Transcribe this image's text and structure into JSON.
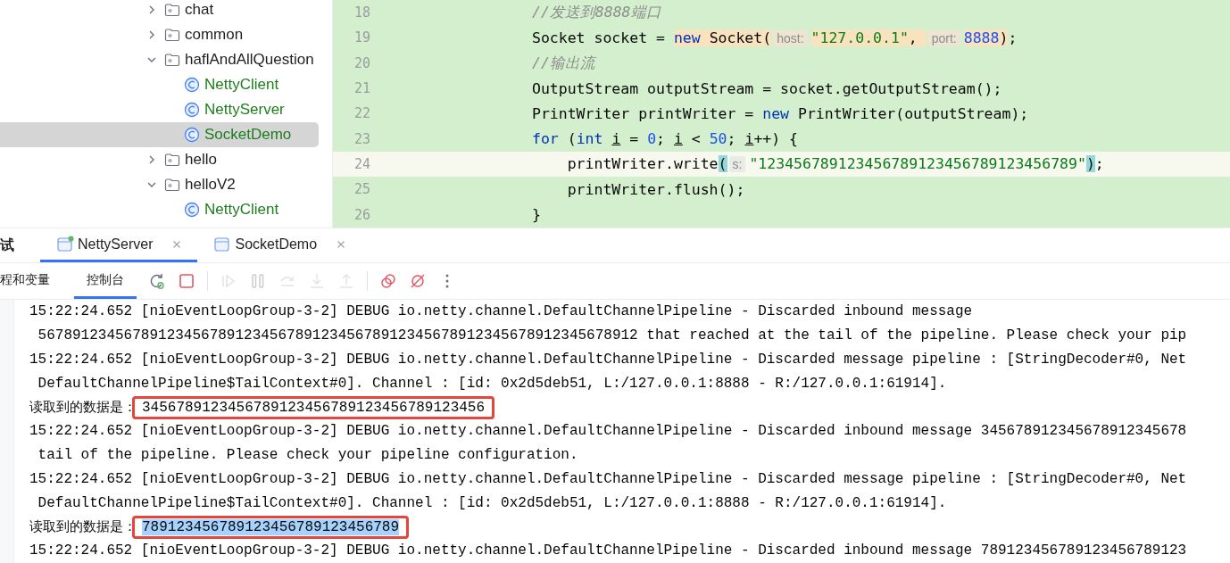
{
  "project_tree": {
    "items": [
      {
        "kind": "folder",
        "label": "chat",
        "expanded": false,
        "selected": false
      },
      {
        "kind": "folder",
        "label": "common",
        "expanded": false,
        "selected": false
      },
      {
        "kind": "folder",
        "label": "haflAndAllQuestion",
        "expanded": true,
        "selected": false,
        "children": [
          {
            "kind": "class",
            "label": "NettyClient",
            "selected": false
          },
          {
            "kind": "class",
            "label": "NettyServer",
            "selected": false
          },
          {
            "kind": "class",
            "label": "SocketDemo",
            "selected": true
          }
        ]
      },
      {
        "kind": "folder",
        "label": "hello",
        "expanded": false,
        "selected": false
      },
      {
        "kind": "folder",
        "label": "helloV2",
        "expanded": true,
        "selected": false,
        "children": [
          {
            "kind": "class",
            "label": "NettyClient",
            "selected": false
          }
        ]
      }
    ]
  },
  "editor": {
    "lines": [
      {
        "number": "18",
        "current": false,
        "tokens": [
          {
            "kind": "comment",
            "text": "                //发送到8888端口",
            "highlighted": false
          }
        ]
      },
      {
        "number": "19",
        "current": false,
        "tokens": [
          {
            "kind": "plain",
            "text": "                Socket socket = ",
            "highlighted": false
          },
          {
            "kind": "keyword",
            "text": "new",
            "highlighted": true
          },
          {
            "kind": "plain",
            "text": " Socket(",
            "highlighted": true
          },
          {
            "kind": "hint",
            "text": "host:",
            "highlighted": true
          },
          {
            "kind": "string",
            "text": "\"127.0.0.1\"",
            "highlighted": true
          },
          {
            "kind": "plain",
            "text": ", ",
            "highlighted": true
          },
          {
            "kind": "hint",
            "text": "port:",
            "highlighted": true
          },
          {
            "kind": "number",
            "text": "8888",
            "highlighted": true
          },
          {
            "kind": "plain",
            "text": ")",
            "highlighted": true
          },
          {
            "kind": "plain",
            "text": ";",
            "highlighted": false
          }
        ]
      },
      {
        "number": "20",
        "current": false,
        "tokens": [
          {
            "kind": "comment",
            "text": "                //输出流",
            "highlighted": false
          }
        ]
      },
      {
        "number": "21",
        "current": false,
        "tokens": [
          {
            "kind": "plain",
            "text": "                OutputStream outputStream = socket.getOutputStream();",
            "highlighted": false
          }
        ]
      },
      {
        "number": "22",
        "current": false,
        "tokens": [
          {
            "kind": "plain",
            "text": "                PrintWriter printWriter = ",
            "highlighted": false
          },
          {
            "kind": "keyword",
            "text": "new",
            "highlighted": false
          },
          {
            "kind": "plain",
            "text": " PrintWriter(outputStream);",
            "highlighted": false
          }
        ]
      },
      {
        "number": "23",
        "current": false,
        "tokens": [
          {
            "kind": "keyword",
            "text": "                for",
            "highlighted": false
          },
          {
            "kind": "plain",
            "text": " (",
            "highlighted": false
          },
          {
            "kind": "keyword",
            "text": "int ",
            "highlighted": false
          },
          {
            "kind": "variable",
            "text": "i",
            "highlighted": false
          },
          {
            "kind": "plain",
            "text": " = ",
            "highlighted": false
          },
          {
            "kind": "number",
            "text": "0",
            "highlighted": false
          },
          {
            "kind": "plain",
            "text": "; ",
            "highlighted": false
          },
          {
            "kind": "variable",
            "text": "i",
            "highlighted": false
          },
          {
            "kind": "plain",
            "text": " < ",
            "highlighted": false
          },
          {
            "kind": "number",
            "text": "50",
            "highlighted": false
          },
          {
            "kind": "plain",
            "text": "; ",
            "highlighted": false
          },
          {
            "kind": "variable",
            "text": "i",
            "highlighted": false
          },
          {
            "kind": "plain",
            "text": "++) {",
            "highlighted": false
          }
        ]
      },
      {
        "number": "24",
        "current": true,
        "tokens": [
          {
            "kind": "plain",
            "text": "                    printWriter.write",
            "highlighted": false
          },
          {
            "kind": "plain",
            "text": "(",
            "highlighted": true
          },
          {
            "kind": "hint",
            "text": "s:",
            "highlighted": false
          },
          {
            "kind": "string",
            "text": "\"123456789123456789123456789123456789\"",
            "highlighted": false
          },
          {
            "kind": "plain",
            "text": ")",
            "highlighted": true
          },
          {
            "kind": "plain",
            "text": ";",
            "highlighted": false
          }
        ]
      },
      {
        "number": "25",
        "current": false,
        "tokens": [
          {
            "kind": "plain",
            "text": "                    printWriter.flush();",
            "highlighted": false
          }
        ]
      },
      {
        "number": "26",
        "current": false,
        "tokens": [
          {
            "kind": "plain",
            "text": "                }",
            "highlighted": false
          }
        ]
      }
    ]
  },
  "debug_panel": {
    "title": "试",
    "tabs": [
      {
        "label": "NettyServer",
        "selected": true,
        "running": true
      },
      {
        "label": "SocketDemo",
        "selected": false,
        "running": false
      }
    ],
    "subtabs": [
      {
        "label": "程和变量",
        "selected": false
      },
      {
        "label": "控制台",
        "selected": true
      }
    ],
    "toolbar": [
      {
        "kind": "rerun",
        "disabled": false
      },
      {
        "kind": "stop",
        "disabled": false
      },
      {
        "kind": "separator"
      },
      {
        "kind": "resume",
        "disabled": true
      },
      {
        "kind": "pause",
        "disabled": true
      },
      {
        "kind": "step-over",
        "disabled": true
      },
      {
        "kind": "step-into",
        "disabled": true
      },
      {
        "kind": "step-out",
        "disabled": true
      },
      {
        "kind": "separator"
      },
      {
        "kind": "breakpoints",
        "disabled": false
      },
      {
        "kind": "mute",
        "disabled": false
      },
      {
        "kind": "more",
        "disabled": false
      }
    ]
  },
  "console": {
    "lines": [
      {
        "kind": "log",
        "text": "15:22:24.652 [nioEventLoopGroup-3-2] DEBUG io.netty.channel.DefaultChannelPipeline - Discarded inbound message"
      },
      {
        "kind": "log",
        "text": " 5678912345678912345678912345678912345678912345678912345678912345678912 that reached at the tail of the pipeline. Please check your pip"
      },
      {
        "kind": "log",
        "text": "15:22:24.652 [nioEventLoopGroup-3-2] DEBUG io.netty.channel.DefaultChannelPipeline - Discarded message pipeline : [StringDecoder#0, Net"
      },
      {
        "kind": "log",
        "text": " DefaultChannelPipeline$TailContext#0]. Channel : [id: 0x2d5deb51, L:/127.0.0.1:8888 - R:/127.0.0.1:61914]."
      },
      {
        "kind": "output",
        "label": "读取到的数据是：",
        "value": "3456789123456789123456789123456789123456",
        "boxed": true,
        "selected": false
      },
      {
        "kind": "log",
        "text": "15:22:24.652 [nioEventLoopGroup-3-2] DEBUG io.netty.channel.DefaultChannelPipeline - Discarded inbound message 345678912345678912345678"
      },
      {
        "kind": "log",
        "text": " tail of the pipeline. Please check your pipeline configuration."
      },
      {
        "kind": "log",
        "text": "15:22:24.652 [nioEventLoopGroup-3-2] DEBUG io.netty.channel.DefaultChannelPipeline - Discarded message pipeline : [StringDecoder#0, Net"
      },
      {
        "kind": "log",
        "text": " DefaultChannelPipeline$TailContext#0]. Channel : [id: 0x2d5deb51, L:/127.0.0.1:8888 - R:/127.0.0.1:61914]."
      },
      {
        "kind": "output",
        "label": "读取到的数据是：",
        "value": "789123456789123456789123456789",
        "boxed": true,
        "selected": true
      },
      {
        "kind": "log",
        "text": "15:22:24.652 [nioEventLoopGroup-3-2] DEBUG io.netty.channel.DefaultChannelPipeline - Discarded inbound message 789123456789123456789123"
      }
    ]
  }
}
